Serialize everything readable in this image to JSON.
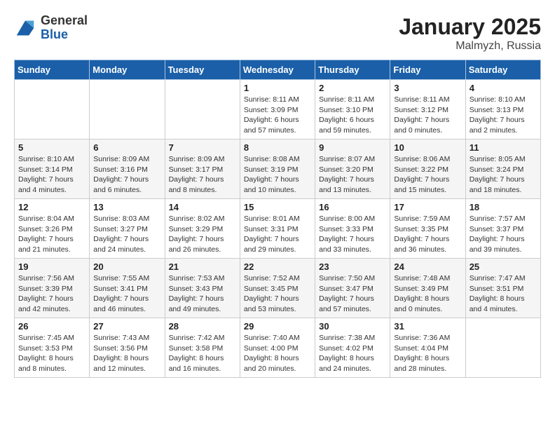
{
  "header": {
    "logo_line1": "General",
    "logo_line2": "Blue",
    "title": "January 2025",
    "subtitle": "Malmyzh, Russia"
  },
  "days_of_week": [
    "Sunday",
    "Monday",
    "Tuesday",
    "Wednesday",
    "Thursday",
    "Friday",
    "Saturday"
  ],
  "weeks": [
    [
      {
        "day": "",
        "sunrise": "",
        "sunset": "",
        "daylight": ""
      },
      {
        "day": "",
        "sunrise": "",
        "sunset": "",
        "daylight": ""
      },
      {
        "day": "",
        "sunrise": "",
        "sunset": "",
        "daylight": ""
      },
      {
        "day": "1",
        "sunrise": "Sunrise: 8:11 AM",
        "sunset": "Sunset: 3:09 PM",
        "daylight": "Daylight: 6 hours and 57 minutes."
      },
      {
        "day": "2",
        "sunrise": "Sunrise: 8:11 AM",
        "sunset": "Sunset: 3:10 PM",
        "daylight": "Daylight: 6 hours and 59 minutes."
      },
      {
        "day": "3",
        "sunrise": "Sunrise: 8:11 AM",
        "sunset": "Sunset: 3:12 PM",
        "daylight": "Daylight: 7 hours and 0 minutes."
      },
      {
        "day": "4",
        "sunrise": "Sunrise: 8:10 AM",
        "sunset": "Sunset: 3:13 PM",
        "daylight": "Daylight: 7 hours and 2 minutes."
      }
    ],
    [
      {
        "day": "5",
        "sunrise": "Sunrise: 8:10 AM",
        "sunset": "Sunset: 3:14 PM",
        "daylight": "Daylight: 7 hours and 4 minutes."
      },
      {
        "day": "6",
        "sunrise": "Sunrise: 8:09 AM",
        "sunset": "Sunset: 3:16 PM",
        "daylight": "Daylight: 7 hours and 6 minutes."
      },
      {
        "day": "7",
        "sunrise": "Sunrise: 8:09 AM",
        "sunset": "Sunset: 3:17 PM",
        "daylight": "Daylight: 7 hours and 8 minutes."
      },
      {
        "day": "8",
        "sunrise": "Sunrise: 8:08 AM",
        "sunset": "Sunset: 3:19 PM",
        "daylight": "Daylight: 7 hours and 10 minutes."
      },
      {
        "day": "9",
        "sunrise": "Sunrise: 8:07 AM",
        "sunset": "Sunset: 3:20 PM",
        "daylight": "Daylight: 7 hours and 13 minutes."
      },
      {
        "day": "10",
        "sunrise": "Sunrise: 8:06 AM",
        "sunset": "Sunset: 3:22 PM",
        "daylight": "Daylight: 7 hours and 15 minutes."
      },
      {
        "day": "11",
        "sunrise": "Sunrise: 8:05 AM",
        "sunset": "Sunset: 3:24 PM",
        "daylight": "Daylight: 7 hours and 18 minutes."
      }
    ],
    [
      {
        "day": "12",
        "sunrise": "Sunrise: 8:04 AM",
        "sunset": "Sunset: 3:26 PM",
        "daylight": "Daylight: 7 hours and 21 minutes."
      },
      {
        "day": "13",
        "sunrise": "Sunrise: 8:03 AM",
        "sunset": "Sunset: 3:27 PM",
        "daylight": "Daylight: 7 hours and 24 minutes."
      },
      {
        "day": "14",
        "sunrise": "Sunrise: 8:02 AM",
        "sunset": "Sunset: 3:29 PM",
        "daylight": "Daylight: 7 hours and 26 minutes."
      },
      {
        "day": "15",
        "sunrise": "Sunrise: 8:01 AM",
        "sunset": "Sunset: 3:31 PM",
        "daylight": "Daylight: 7 hours and 29 minutes."
      },
      {
        "day": "16",
        "sunrise": "Sunrise: 8:00 AM",
        "sunset": "Sunset: 3:33 PM",
        "daylight": "Daylight: 7 hours and 33 minutes."
      },
      {
        "day": "17",
        "sunrise": "Sunrise: 7:59 AM",
        "sunset": "Sunset: 3:35 PM",
        "daylight": "Daylight: 7 hours and 36 minutes."
      },
      {
        "day": "18",
        "sunrise": "Sunrise: 7:57 AM",
        "sunset": "Sunset: 3:37 PM",
        "daylight": "Daylight: 7 hours and 39 minutes."
      }
    ],
    [
      {
        "day": "19",
        "sunrise": "Sunrise: 7:56 AM",
        "sunset": "Sunset: 3:39 PM",
        "daylight": "Daylight: 7 hours and 42 minutes."
      },
      {
        "day": "20",
        "sunrise": "Sunrise: 7:55 AM",
        "sunset": "Sunset: 3:41 PM",
        "daylight": "Daylight: 7 hours and 46 minutes."
      },
      {
        "day": "21",
        "sunrise": "Sunrise: 7:53 AM",
        "sunset": "Sunset: 3:43 PM",
        "daylight": "Daylight: 7 hours and 49 minutes."
      },
      {
        "day": "22",
        "sunrise": "Sunrise: 7:52 AM",
        "sunset": "Sunset: 3:45 PM",
        "daylight": "Daylight: 7 hours and 53 minutes."
      },
      {
        "day": "23",
        "sunrise": "Sunrise: 7:50 AM",
        "sunset": "Sunset: 3:47 PM",
        "daylight": "Daylight: 7 hours and 57 minutes."
      },
      {
        "day": "24",
        "sunrise": "Sunrise: 7:48 AM",
        "sunset": "Sunset: 3:49 PM",
        "daylight": "Daylight: 8 hours and 0 minutes."
      },
      {
        "day": "25",
        "sunrise": "Sunrise: 7:47 AM",
        "sunset": "Sunset: 3:51 PM",
        "daylight": "Daylight: 8 hours and 4 minutes."
      }
    ],
    [
      {
        "day": "26",
        "sunrise": "Sunrise: 7:45 AM",
        "sunset": "Sunset: 3:53 PM",
        "daylight": "Daylight: 8 hours and 8 minutes."
      },
      {
        "day": "27",
        "sunrise": "Sunrise: 7:43 AM",
        "sunset": "Sunset: 3:56 PM",
        "daylight": "Daylight: 8 hours and 12 minutes."
      },
      {
        "day": "28",
        "sunrise": "Sunrise: 7:42 AM",
        "sunset": "Sunset: 3:58 PM",
        "daylight": "Daylight: 8 hours and 16 minutes."
      },
      {
        "day": "29",
        "sunrise": "Sunrise: 7:40 AM",
        "sunset": "Sunset: 4:00 PM",
        "daylight": "Daylight: 8 hours and 20 minutes."
      },
      {
        "day": "30",
        "sunrise": "Sunrise: 7:38 AM",
        "sunset": "Sunset: 4:02 PM",
        "daylight": "Daylight: 8 hours and 24 minutes."
      },
      {
        "day": "31",
        "sunrise": "Sunrise: 7:36 AM",
        "sunset": "Sunset: 4:04 PM",
        "daylight": "Daylight: 8 hours and 28 minutes."
      },
      {
        "day": "",
        "sunrise": "",
        "sunset": "",
        "daylight": ""
      }
    ]
  ]
}
